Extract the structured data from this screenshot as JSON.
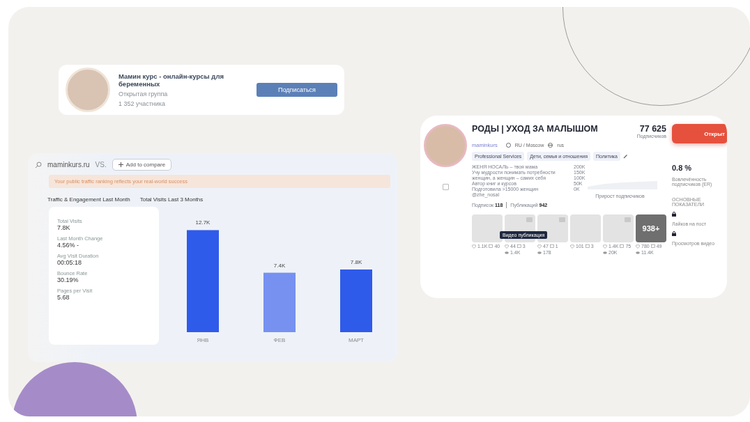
{
  "group_card": {
    "title": "Мамин курс - онлайн-курсы для беременных",
    "type": "Открытая группа",
    "members": "1 352 участника",
    "button": "Подписаться"
  },
  "traffic_panel": {
    "site": "maminkurs.ru",
    "vs": "VS.",
    "compare_button": "Add to compare",
    "banner": "Your public traffic ranking reflects your real-world success",
    "engagement_title": "Traffic & Engagement Last Month",
    "visits_title": "Total Visits Last 3 Months",
    "metrics": [
      {
        "label": "Total Visits",
        "value": "7.8K"
      },
      {
        "label": "Last Month Change",
        "value": "4.56% -"
      },
      {
        "label": "Avg Visit Duration",
        "value": "00:05:18"
      },
      {
        "label": "Bounce Rate",
        "value": "30.19%"
      },
      {
        "label": "Pages per Visit",
        "value": "5.68"
      }
    ],
    "chart_data": {
      "type": "bar",
      "categories": [
        "ЯНВ",
        "ФЕВ",
        "МАРТ"
      ],
      "values": [
        12700,
        7400,
        7800
      ],
      "value_labels": [
        "12.7K",
        "7.4K",
        "7.8K"
      ]
    }
  },
  "channel_panel": {
    "title": "РОДЫ | УХОД ЗА МАЛЫШОМ",
    "handle": "maminkurs",
    "location": "RU / Moscow",
    "language": "rus",
    "subscribers": "77 625",
    "subscribers_label": "Подписчиков",
    "open_button": "Открыт",
    "checked": false,
    "tags": [
      "Professional Services",
      "Дети, семья и отношения",
      "Политика"
    ],
    "description": [
      "ЖЕНЯ НОСАЛЬ – твоя мама",
      "Учу мудрости понимать потребности",
      "женщин, а женщин – самих себя",
      "Автор книг и курсов",
      "Подготовила >15000 женщин",
      "@zhe_nosal"
    ],
    "following_label": "Подписок",
    "following": "118",
    "posts_label": "Публикаций",
    "posts_count": "942",
    "growth_axis": [
      "200K",
      "150K",
      "100K",
      "50K",
      "0K"
    ],
    "growth_label": "Прирост подписчиков",
    "posts": [
      {
        "kind": "photo",
        "likes": "1.1K",
        "comments": "40"
      },
      {
        "kind": "video",
        "likes": "44",
        "comments": "3",
        "views": "1.4K"
      },
      {
        "kind": "video",
        "likes": "47",
        "comments": "1",
        "views": "178"
      },
      {
        "kind": "photo",
        "likes": "101",
        "comments": "3"
      },
      {
        "kind": "video",
        "likes": "1.4K",
        "comments": "75",
        "views": "20K"
      },
      {
        "kind": "more",
        "more": "938+",
        "likes": "780",
        "comments": "49",
        "views": "11.4K"
      }
    ],
    "tooltip": "Видео публикация",
    "er": "0.8 %",
    "er_label": "Вовлечённость подписчиков (ER)",
    "key_metrics": "ОСНОВНЫЕ ПОКАЗАТЕЛИ",
    "locked": [
      "Лайков на пост",
      "Просмотров видео"
    ]
  }
}
